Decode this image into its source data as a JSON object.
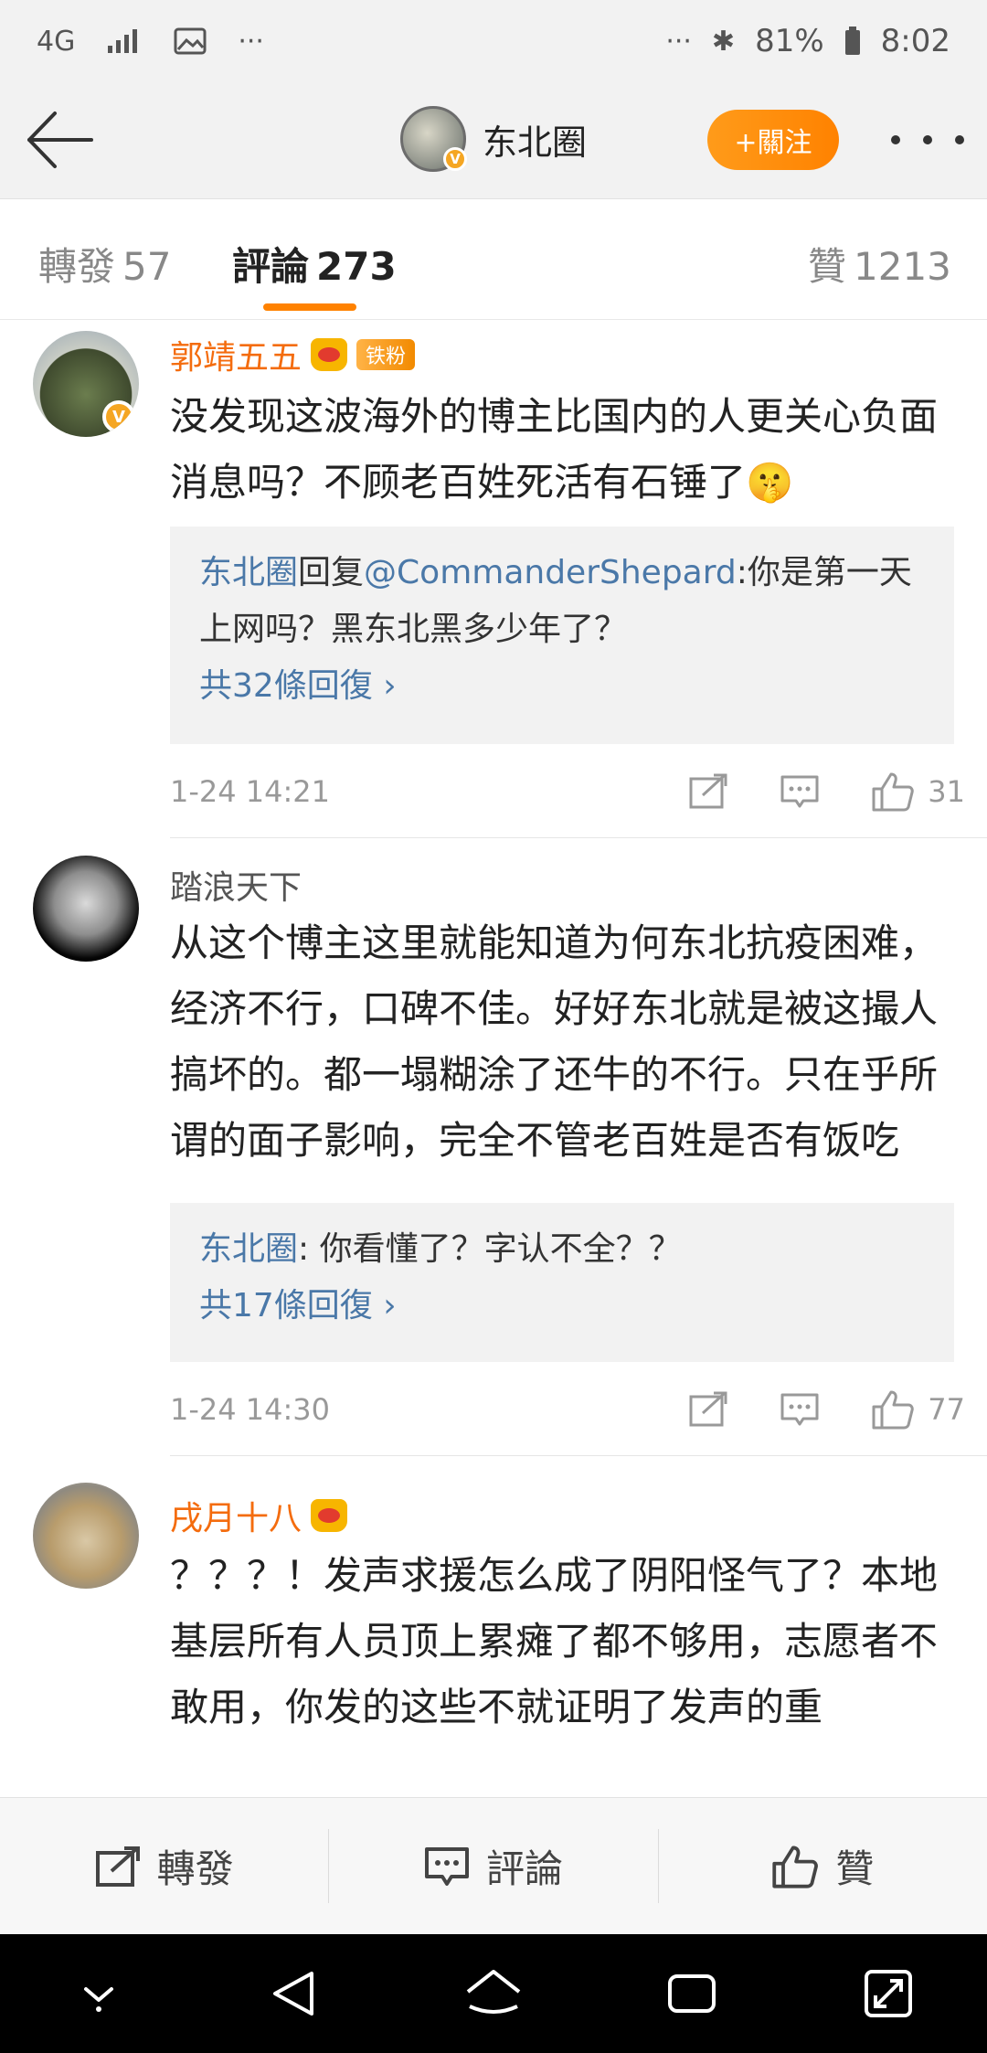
{
  "status_bar": {
    "network": "4G",
    "more_dots": "···",
    "right_dots": "···",
    "battery": "81%",
    "time": "8:02"
  },
  "nav": {
    "title": "东北圈",
    "follow_label": "+關注",
    "verified_mark": "V"
  },
  "tabs": [
    {
      "label": "轉發",
      "count": "57"
    },
    {
      "label": "評論",
      "count": "273"
    },
    {
      "label": "贊",
      "count": "1213"
    }
  ],
  "comments": [
    {
      "username": "郭靖五五",
      "fan_badge": "铁粉",
      "text": "没发现这波海外的博主比国内的人更关心负面消息吗？不顾老百姓死活有石锤了🤫",
      "reply": {
        "author": "东北圈",
        "connector": "回复",
        "mention": "@CommanderShepard",
        "text": ":你是第一天上网吗？黑东北黑多少年了？",
        "count_label": "共32條回復 ›"
      },
      "time": "1-24 14:21",
      "likes": "31"
    },
    {
      "username": "踏浪天下",
      "text": "从这个博主这里就能知道为何东北抗疫困难，经济不行，口碑不佳。好好东北就是被这撮人搞坏的。都一塌糊涂了还牛的不行。只在乎所谓的面子影响，完全不管老百姓是否有饭吃",
      "reply": {
        "author": "东北圈",
        "text": ": 你看懂了？字认不全？？",
        "count_label": "共17條回復 ›"
      },
      "time": "1-24 14:30",
      "likes": "77"
    },
    {
      "username": "戌月十八",
      "text": "？？？！发声求援怎么成了阴阳怪气了？本地基层所有人员顶上累瘫了都不够用，志愿者不敢用，你发的这些不就证明了发声的重"
    }
  ],
  "bottom_bar": {
    "repost": "轉發",
    "comment": "評論",
    "like": "贊"
  },
  "colors": {
    "accent": "#ff8200",
    "link": "#4a78a8",
    "vip_name": "#f46c0e"
  }
}
